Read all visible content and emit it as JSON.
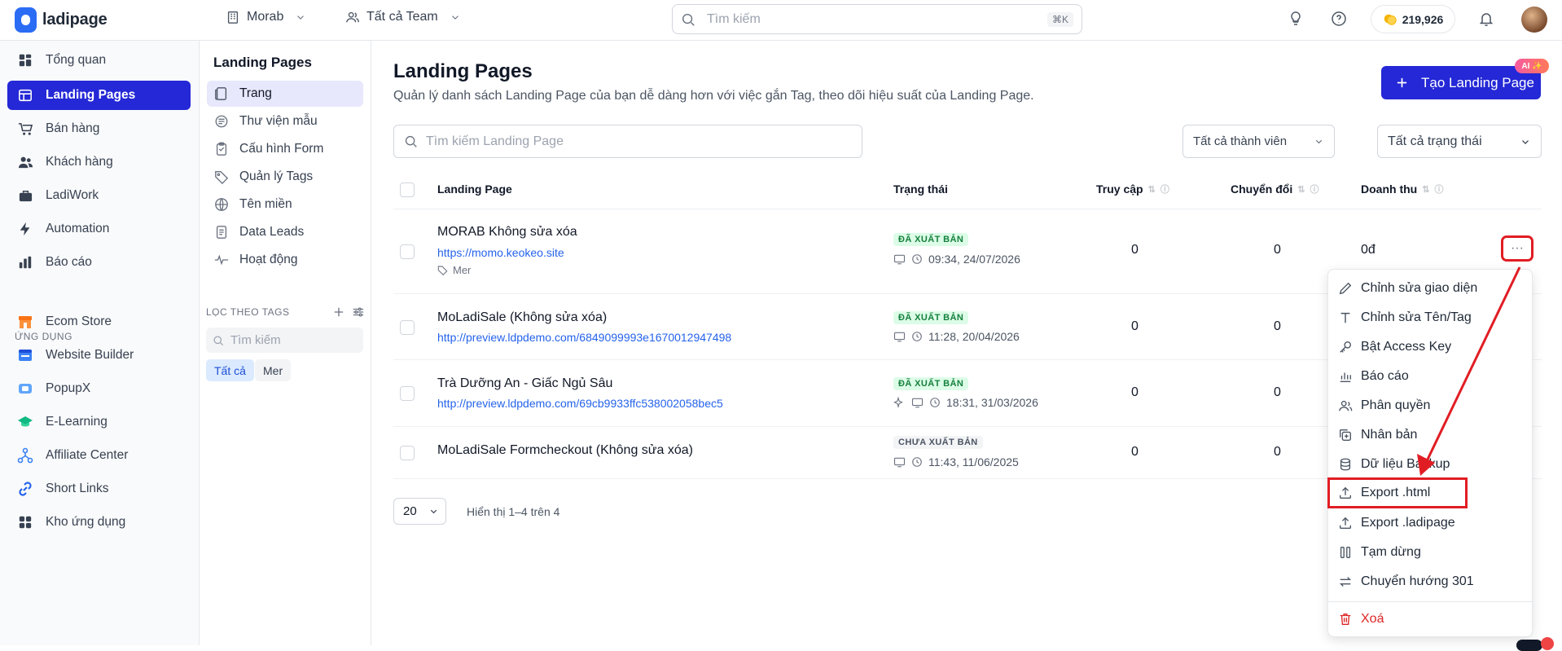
{
  "app": {
    "name": "ladipage"
  },
  "topbar": {
    "workspace": "Morab",
    "team": "Tất cả Team",
    "search_placeholder": "Tìm kiếm",
    "search_shortcut": "⌘K",
    "credits": "219,926"
  },
  "sidebar": {
    "items": [
      {
        "label": "Tổng quan",
        "icon": "dashboard-icon"
      },
      {
        "label": "Landing Pages",
        "icon": "layout-icon"
      },
      {
        "label": "Bán hàng",
        "icon": "cart-icon"
      },
      {
        "label": "Khách hàng",
        "icon": "users-icon"
      },
      {
        "label": "LadiWork",
        "icon": "briefcase-icon"
      },
      {
        "label": "Automation",
        "icon": "lightning-icon"
      },
      {
        "label": "Báo cáo",
        "icon": "bar-chart-icon"
      }
    ],
    "section_label": "ỨNG DỤNG",
    "apps": [
      {
        "label": "Ecom Store",
        "icon": "store-icon"
      },
      {
        "label": "Website Builder",
        "icon": "website-icon"
      },
      {
        "label": "PopupX",
        "icon": "popup-icon"
      },
      {
        "label": "E-Learning",
        "icon": "graduation-icon"
      },
      {
        "label": "Affiliate Center",
        "icon": "network-icon"
      },
      {
        "label": "Short Links",
        "icon": "link-icon"
      },
      {
        "label": "Kho ứng dụng",
        "icon": "apps-icon"
      }
    ]
  },
  "subnav": {
    "title": "Landing Pages",
    "items": [
      {
        "label": "Trang"
      },
      {
        "label": "Thư viện mẫu"
      },
      {
        "label": "Cấu hình Form"
      },
      {
        "label": "Quản lý Tags"
      },
      {
        "label": "Tên miền"
      },
      {
        "label": "Data Leads"
      },
      {
        "label": "Hoạt động"
      }
    ],
    "tags_header": "LỌC THEO TAGS",
    "tags_search_placeholder": "Tìm kiếm",
    "chips": [
      "Tất cả",
      "Mer"
    ]
  },
  "main": {
    "title": "Landing Pages",
    "subtitle": "Quản lý danh sách Landing Page của bạn dễ dàng hơn với việc gắn Tag, theo dõi hiệu suất của Landing Page.",
    "create_button": "Tạo Landing Page",
    "ai_badge": "AI ✨",
    "search_placeholder": "Tìm kiếm Landing Page",
    "member_filter": "Tất cả thành viên",
    "status_filter": "Tất cả trạng thái",
    "columns": [
      "Landing Page",
      "Trạng thái",
      "Truy cập",
      "Chuyển đổi",
      "Doanh thu"
    ],
    "rows": [
      {
        "title": "MORAB Không sửa xóa",
        "url": "https://momo.keokeo.site",
        "tag": "Mer",
        "status": "ĐÃ XUẤT BẢN",
        "time": "09:34, 24/07/2026",
        "visits": "0",
        "conversions": "0",
        "revenue": "0đ"
      },
      {
        "title": "MoLadiSale (Không sửa xóa)",
        "url": "http://preview.ldpdemo.com/6849099993e1670012947498",
        "tag": "",
        "status": "ĐÃ XUẤT BẢN",
        "time": "11:28, 20/04/2026",
        "visits": "0",
        "conversions": "0",
        "revenue": ""
      },
      {
        "title": "Trà Dưỡng An - Giấc Ngủ Sâu",
        "url": "http://preview.ldpdemo.com/69cb9933ffc538002058bec5",
        "tag": "",
        "status": "ĐÃ XUẤT BẢN",
        "time": "18:31, 31/03/2026",
        "visits": "0",
        "conversions": "0",
        "revenue": ""
      },
      {
        "title": "MoLadiSale Formcheckout (Không sửa xóa)",
        "url": "",
        "tag": "",
        "status": "CHƯA XUẤT BẢN",
        "time": "11:43, 11/06/2025",
        "visits": "0",
        "conversions": "0",
        "revenue": ""
      }
    ],
    "page_size": "20",
    "pagination_info": "Hiển thị 1–4 trên 4"
  },
  "context_menu": {
    "items": [
      {
        "label": "Chỉnh sửa giao diện",
        "icon": "pencil-icon"
      },
      {
        "label": "Chỉnh sửa Tên/Tag",
        "icon": "text-icon"
      },
      {
        "label": "Bật Access Key",
        "icon": "key-icon"
      },
      {
        "label": "Báo cáo",
        "icon": "bar-chart-icon"
      },
      {
        "label": "Phân quyền",
        "icon": "users-icon"
      },
      {
        "label": "Nhân bản",
        "icon": "duplicate-icon"
      },
      {
        "label": "Dữ liệu Backup",
        "icon": "database-icon"
      },
      {
        "label": "Export .html",
        "icon": "upload-icon"
      },
      {
        "label": "Export .ladipage",
        "icon": "upload-icon"
      },
      {
        "label": "Tạm dừng",
        "icon": "pause-icon"
      },
      {
        "label": "Chuyển hướng 301",
        "icon": "swap-icon"
      },
      {
        "label": "Xoá",
        "icon": "trash-icon"
      }
    ]
  },
  "colors": {
    "primary": "#2428d6",
    "highlight": "#e11d24",
    "link": "#2563eb",
    "published": "#15803d"
  }
}
